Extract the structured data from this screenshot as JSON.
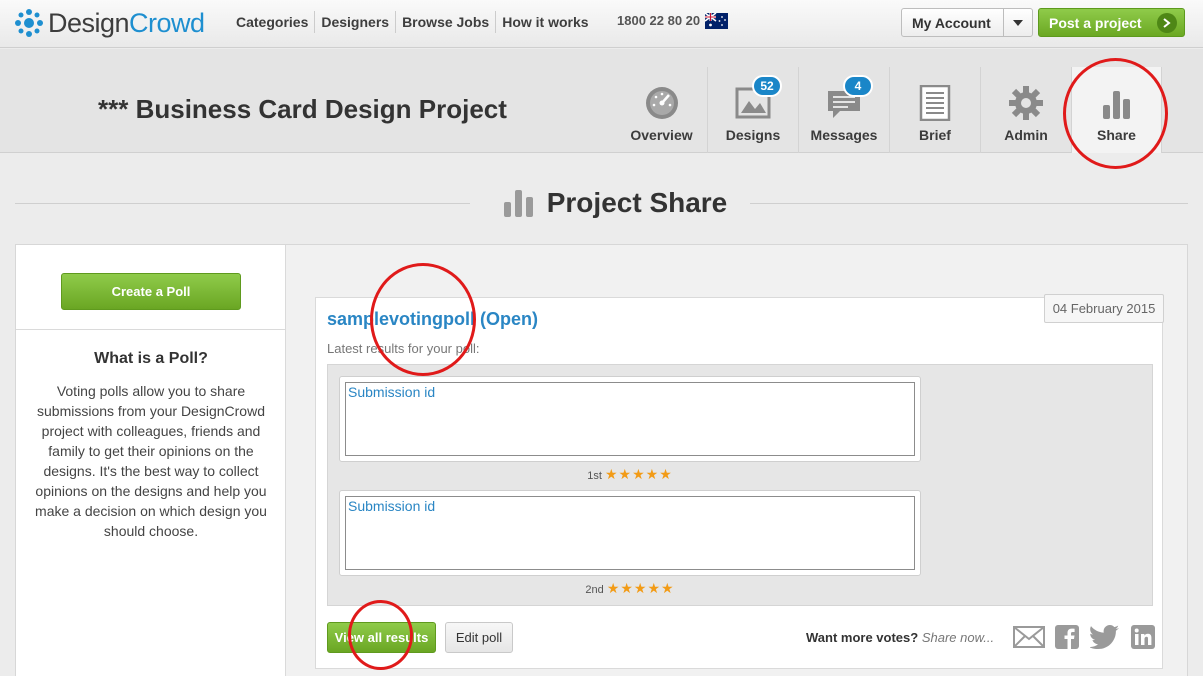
{
  "header": {
    "logo_design": "Design",
    "logo_crowd": "Crowd",
    "nav": [
      "Categories",
      "Designers",
      "Browse Jobs",
      "How it works"
    ],
    "phone": "1800 22 80 20",
    "my_account": "My Account",
    "post_project": "Post a project"
  },
  "project": {
    "title": "*** Business Card Design Project",
    "tabs": [
      {
        "label": "Overview",
        "icon": "gauge-icon"
      },
      {
        "label": "Designs",
        "icon": "image-icon",
        "badge": "52"
      },
      {
        "label": "Messages",
        "icon": "chat-icon",
        "badge": "4"
      },
      {
        "label": "Brief",
        "icon": "document-icon"
      },
      {
        "label": "Admin",
        "icon": "gear-icon"
      },
      {
        "label": "Share",
        "icon": "bar-chart-icon"
      }
    ]
  },
  "section": {
    "title": "Project Share"
  },
  "sidebar": {
    "create_poll": "Create a Poll",
    "heading": "What is a Poll?",
    "description": "Voting polls allow you to share submissions from your DesignCrowd project with colleagues, friends and family to get their opinions on the designs. It's the best way to collect opinions on the designs and help you make a decision on which design you should choose."
  },
  "poll": {
    "name": "samplevotingpoll",
    "status": "(Open)",
    "date": "04 February 2015",
    "latest_label": "Latest results for your poll:",
    "results": [
      {
        "label": "Submission id",
        "rank": "1st",
        "stars": "★★★★★"
      },
      {
        "label": "Submission id",
        "rank": "2nd",
        "stars": "★★★★★"
      }
    ],
    "view_all": "View all results",
    "edit": "Edit poll",
    "want_more": "Want more votes?",
    "share_now": "Share now...",
    "share_icons": [
      "email-icon",
      "facebook-icon",
      "twitter-icon",
      "linkedin-icon"
    ]
  },
  "colors": {
    "accent_blue": "#2a86c4",
    "green": "#7ab735",
    "annotation_red": "#e01a1a",
    "star": "#f29b16"
  }
}
